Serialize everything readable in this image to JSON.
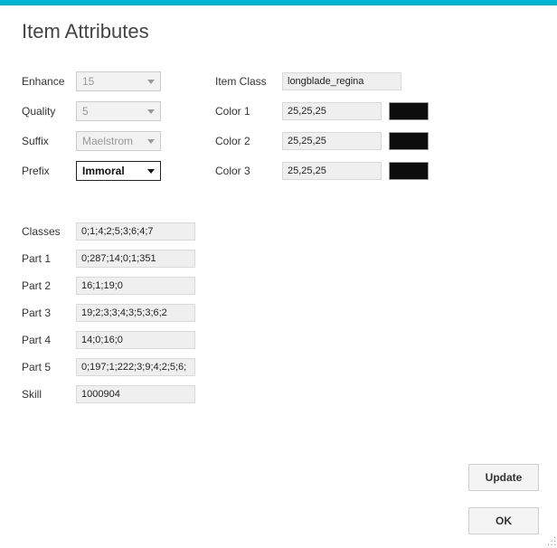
{
  "title": "Item Attributes",
  "left": {
    "enhance": {
      "label": "Enhance",
      "value": "15"
    },
    "quality": {
      "label": "Quality",
      "value": "5"
    },
    "suffix": {
      "label": "Suffix",
      "value": "Maelstrom"
    },
    "prefix": {
      "label": "Prefix",
      "value": "Immoral"
    }
  },
  "right": {
    "itemclass": {
      "label": "Item Class",
      "value": "longblade_regina"
    },
    "color1": {
      "label": "Color 1",
      "value": "25,25,25",
      "hex": "#0d0d0d"
    },
    "color2": {
      "label": "Color 2",
      "value": "25,25,25",
      "hex": "#0d0d0d"
    },
    "color3": {
      "label": "Color 3",
      "value": "25,25,25",
      "hex": "#0d0d0d"
    }
  },
  "lower": {
    "classes": {
      "label": "Classes",
      "value": "0;1;4;2;5;3;6;4;7"
    },
    "part1": {
      "label": "Part 1",
      "value": "0;287;14;0;1;351"
    },
    "part2": {
      "label": "Part 2",
      "value": "16;1;19;0"
    },
    "part3": {
      "label": "Part 3",
      "value": "19;2;3;3;4;3;5;3;6;2"
    },
    "part4": {
      "label": "Part 4",
      "value": "14;0;16;0"
    },
    "part5": {
      "label": "Part 5",
      "value": "0;197;1;222;3;9;4;2;5;6;"
    },
    "skill": {
      "label": "Skill",
      "value": "1000904"
    }
  },
  "buttons": {
    "update": "Update",
    "ok": "OK"
  }
}
